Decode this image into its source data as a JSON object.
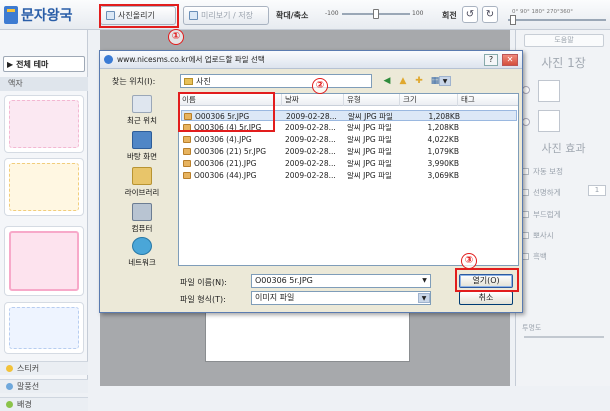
{
  "app": {
    "logo": "문자왕국",
    "toolbar": {
      "upload_label": "사진올리기",
      "preview_label": "미리보기 / 저장",
      "zoom_label": "확대/축소",
      "zoom_min": "-100",
      "zoom_max": "100",
      "rotate_label": "회전",
      "rotate_ticks": "0°  90°  180°  270°360°"
    },
    "left": {
      "theme_select": "전체 테마",
      "tab_background": "액자",
      "bottom_tabs": [
        "스티커",
        "말풍선",
        "배경"
      ]
    },
    "right": {
      "help_label": "도움말",
      "photo_count": "사진 1장",
      "effect_title": "사진 효과",
      "effects": [
        "자동 보정",
        "선명하게",
        "부드럽게",
        "뽀사시",
        "흑백"
      ],
      "sharp_value": "1",
      "alpha_label": "투명도"
    }
  },
  "dialog": {
    "title": "www.nicesms.co.kr에서 업로드할 파일 선택",
    "lookin_label": "찾는 위치(I):",
    "lookin_value": "사진",
    "places": [
      "최근 위치",
      "바탕 화면",
      "라이브러리",
      "컴퓨터",
      "네트워크"
    ],
    "columns": [
      "이름",
      "날짜",
      "유형",
      "크기",
      "태그"
    ],
    "files": [
      {
        "name": "O00306  5r.JPG",
        "date": "2009-02-28...",
        "type": "알씨 JPG 파일",
        "size": "1,208KB"
      },
      {
        "name": "O00306  (4) 5r.JPG",
        "date": "2009-02-28...",
        "type": "알씨 JPG 파일",
        "size": "1,208KB"
      },
      {
        "name": "O00306  (4).JPG",
        "date": "2009-02-28...",
        "type": "알씨 JPG 파일",
        "size": "4,022KB"
      },
      {
        "name": "O00306  (21) 5r.JPG",
        "date": "2009-02-28...",
        "type": "알씨 JPG 파일",
        "size": "1,079KB"
      },
      {
        "name": "O00306  (21).JPG",
        "date": "2009-02-28...",
        "type": "알씨 JPG 파일",
        "size": "3,990KB"
      },
      {
        "name": "O00306  (44).JPG",
        "date": "2009-02-28...",
        "type": "알씨 JPG 파일",
        "size": "3,069KB"
      }
    ],
    "filename_label": "파일 이름(N):",
    "filename_value": "O00306  5r.JPG",
    "filetype_label": "파일 형식(T):",
    "filetype_value": "이미지 파일",
    "open_label": "열기(O)",
    "cancel_label": "취소"
  },
  "annotations": [
    "①",
    "②",
    "③"
  ],
  "colors": {
    "annotation_red": "#e21d1d",
    "selection": "#dce8f7",
    "canvas_gray": "#a7a9ac"
  }
}
